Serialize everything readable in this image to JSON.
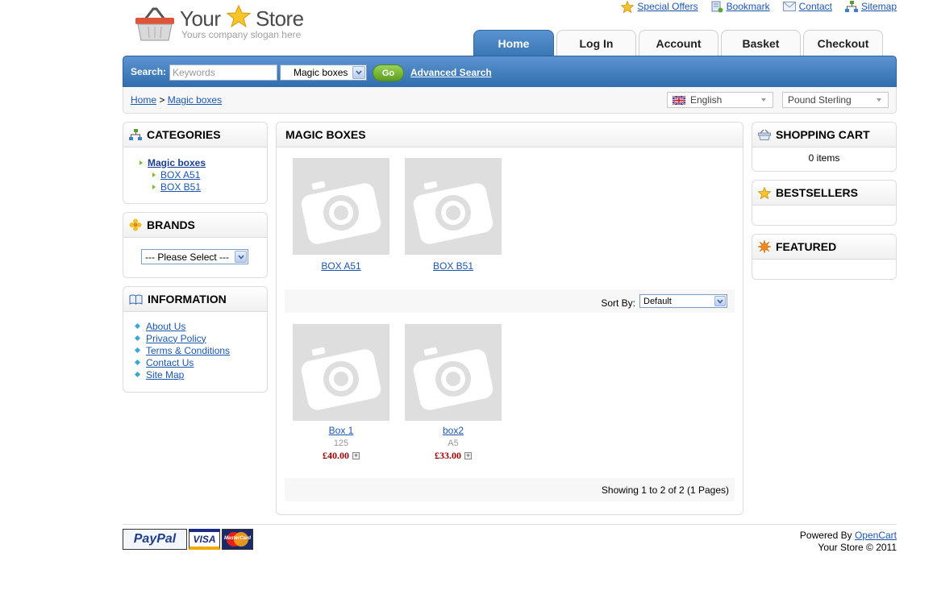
{
  "logo": {
    "word1": "Your",
    "word2": "Store",
    "slogan": "Yours company slogan here"
  },
  "top_links": [
    {
      "label": "Special Offers",
      "icon": "star-icon"
    },
    {
      "label": "Bookmark",
      "icon": "bookmark-icon"
    },
    {
      "label": "Contact",
      "icon": "mail-icon"
    },
    {
      "label": "Sitemap",
      "icon": "sitemap-icon"
    }
  ],
  "tabs": [
    {
      "label": "Home",
      "active": true
    },
    {
      "label": "Log In"
    },
    {
      "label": "Account"
    },
    {
      "label": "Basket"
    },
    {
      "label": "Checkout"
    }
  ],
  "search": {
    "label": "Search:",
    "placeholder": "Keywords",
    "category": "Magic boxes",
    "go": "Go",
    "advanced": "Advanced Search"
  },
  "breadcrumb": {
    "home": "Home",
    "sep": ">",
    "current": "Magic boxes"
  },
  "language": "English",
  "currency": "Pound Sterling",
  "categories": {
    "title": "CATEGORIES",
    "parent": "Magic boxes",
    "children": [
      "BOX A51",
      "BOX B51"
    ]
  },
  "brands": {
    "title": "BRANDS",
    "select": "--- Please Select ---"
  },
  "information": {
    "title": "INFORMATION",
    "links": [
      "About Us",
      "Privacy Policy",
      "Terms & Conditions",
      "Contact Us",
      "Site Map"
    ]
  },
  "main": {
    "title": "MAGIC BOXES",
    "subcategories": [
      "BOX A51",
      "BOX B51"
    ],
    "sort_label": "Sort By:",
    "sort_value": "Default",
    "products": [
      {
        "name": "Box 1",
        "model": "125",
        "price": "£40.00"
      },
      {
        "name": "box2",
        "model": "A5",
        "price": "£33.00"
      }
    ],
    "pagination": "Showing 1 to 2 of 2 (1 Pages)"
  },
  "cart": {
    "title": "SHOPPING CART",
    "items": "0 items"
  },
  "bestsellers": {
    "title": "BESTSELLERS"
  },
  "featured": {
    "title": "FEATURED"
  },
  "footer": {
    "payments": [
      "PayPal",
      "VISA",
      "MasterCard"
    ],
    "powered_by": "Powered By",
    "powered_link": "OpenCart",
    "copyright": "Your Store © 2011"
  },
  "colors": {
    "accent_blue": "#3a75b5",
    "link": "#1b57b1",
    "price": "#990000",
    "go_green": "#5c9e1f"
  }
}
